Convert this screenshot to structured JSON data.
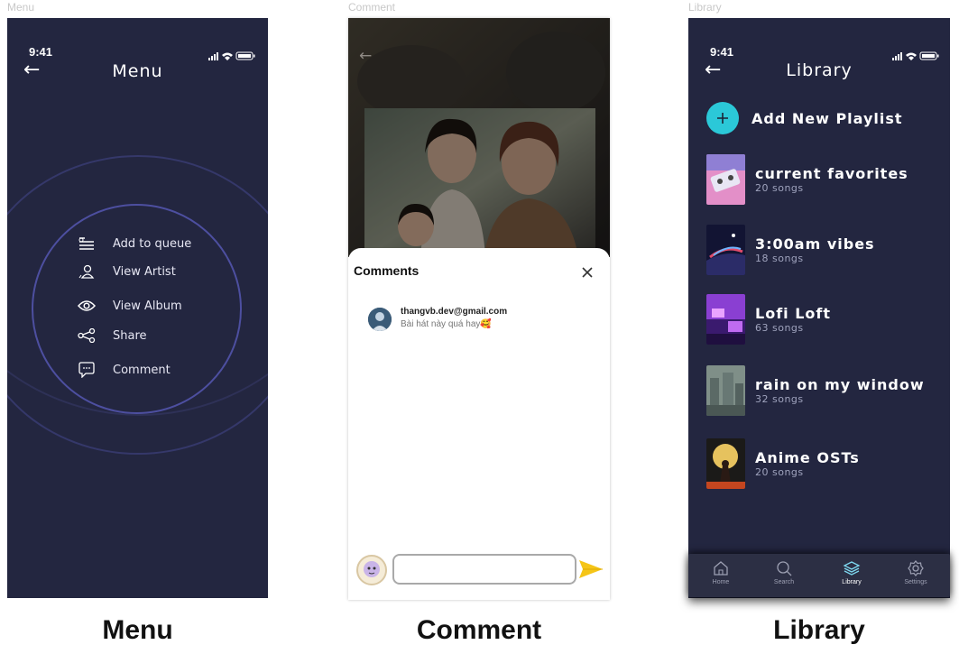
{
  "frame_labels": {
    "menu": "Menu",
    "comment": "Comment",
    "library": "Library"
  },
  "captions": {
    "menu": "Menu",
    "comment": "Comment",
    "library": "Library"
  },
  "status": {
    "time": "9:41"
  },
  "menu_screen": {
    "title": "Menu",
    "items": [
      {
        "label": "Add to queue",
        "icon": "queue-icon"
      },
      {
        "label": "View Artist",
        "icon": "artist-icon"
      },
      {
        "label": "View Album",
        "icon": "eye-icon"
      },
      {
        "label": "Share",
        "icon": "share-icon"
      },
      {
        "label": "Comment",
        "icon": "comment-icon"
      }
    ],
    "ring_color": "#3d3f7a"
  },
  "comment_screen": {
    "sheet_title": "Comments",
    "comments": [
      {
        "user": "thangvb.dev@gmail.com",
        "text": "Bài hát này quá hay🥰"
      }
    ],
    "input_placeholder": "",
    "send_color": "#f5c518"
  },
  "library_screen": {
    "title": "Library",
    "add_playlist_label": "Add New Playlist",
    "accent": "#2bc8d8",
    "playlists": [
      {
        "name": "current favorites",
        "count": "20 songs"
      },
      {
        "name": "3:00am vibes",
        "count": "18 songs"
      },
      {
        "name": "Lofi Loft",
        "count": "63 songs"
      },
      {
        "name": "rain on my window",
        "count": "32 songs"
      },
      {
        "name": "Anime OSTs",
        "count": "20 songs"
      }
    ],
    "tabs": [
      {
        "label": "Home",
        "icon": "home-icon",
        "active": false
      },
      {
        "label": "Search",
        "icon": "search-icon",
        "active": false
      },
      {
        "label": "Library",
        "icon": "layers-icon",
        "active": true
      },
      {
        "label": "Settings",
        "icon": "gear-icon",
        "active": false
      }
    ]
  }
}
